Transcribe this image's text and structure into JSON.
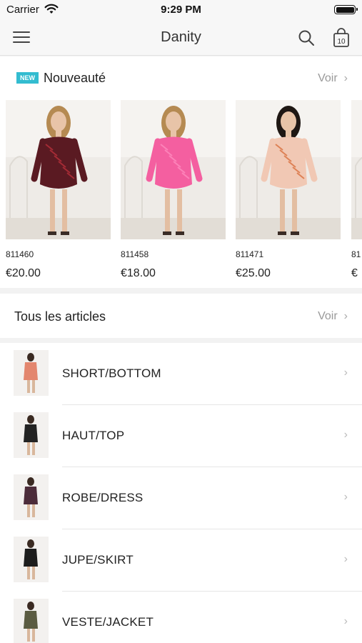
{
  "status": {
    "carrier": "Carrier",
    "time": "9:29 PM"
  },
  "nav": {
    "title": "Danity",
    "cart_count": "10"
  },
  "new_section": {
    "badge": "NEW",
    "title": "Nouveauté",
    "see_all": "Voir",
    "products": [
      {
        "ref": "811460",
        "price": "€20.00",
        "dress_color": "#5a1a22",
        "accent": "#b8303a",
        "hair": "#b58a52"
      },
      {
        "ref": "811458",
        "price": "€18.00",
        "dress_color": "#f45fa0",
        "accent": "#ff8cc0",
        "hair": "#b58a52"
      },
      {
        "ref": "811471",
        "price": "€25.00",
        "dress_color": "#f1c8b4",
        "accent": "#d9703e",
        "hair": "#1e1713"
      },
      {
        "ref": "81",
        "price": "€",
        "dress_color": "#e8e4e0",
        "accent": "#9a9a9a",
        "hair": "#2a2420"
      }
    ]
  },
  "all_section": {
    "title": "Tous les articles",
    "see_all": "Voir"
  },
  "categories": [
    {
      "label": "SHORT/BOTTOM",
      "color": "#e3866e"
    },
    {
      "label": "HAUT/TOP",
      "color": "#232323"
    },
    {
      "label": "ROBE/DRESS",
      "color": "#4c2c3a"
    },
    {
      "label": "JUPE/SKIRT",
      "color": "#1d1d1d"
    },
    {
      "label": "VESTE/JACKET",
      "color": "#5b5c42"
    }
  ],
  "colors": {
    "accent": "#33bcd0",
    "muted": "#999999"
  }
}
